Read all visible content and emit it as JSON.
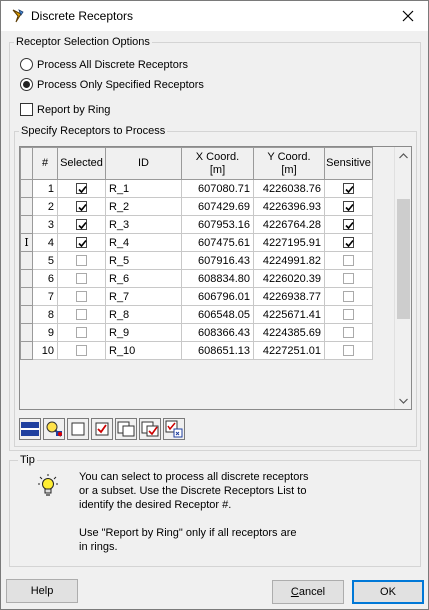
{
  "window": {
    "title": "Discrete Receptors",
    "icon": "receptor-app-icon"
  },
  "selection_options": {
    "label": "Receptor Selection Options",
    "process_all_label": "Process All Discrete Receptors",
    "process_specified_label": "Process Only Specified Receptors",
    "selected_option": "process_specified",
    "report_by_ring_label": "Report by Ring",
    "report_by_ring_checked": false
  },
  "specify_group": {
    "label": "Specify Receptors to Process"
  },
  "grid": {
    "headers": {
      "num": "#",
      "selected": "Selected",
      "id": "ID",
      "x_line1": "X Coord.",
      "x_line2": "[m]",
      "y_line1": "Y Coord.",
      "y_line2": "[m]",
      "sensitive": "Sensitive"
    },
    "current_row_marker": "I",
    "rows": [
      {
        "num": "1",
        "selected": true,
        "id": "R_1",
        "x": "607080.71",
        "y": "4226038.76",
        "sensitive": true
      },
      {
        "num": "2",
        "selected": true,
        "id": "R_2",
        "x": "607429.69",
        "y": "4226396.93",
        "sensitive": true
      },
      {
        "num": "3",
        "selected": true,
        "id": "R_3",
        "x": "607953.16",
        "y": "4226764.28",
        "sensitive": true
      },
      {
        "num": "4",
        "selected": true,
        "id": "R_4",
        "x": "607475.61",
        "y": "4227195.91",
        "sensitive": true
      },
      {
        "num": "5",
        "selected": false,
        "id": "R_5",
        "x": "607916.43",
        "y": "4224991.82",
        "sensitive": false
      },
      {
        "num": "6",
        "selected": false,
        "id": "R_6",
        "x": "608834.80",
        "y": "4226020.39",
        "sensitive": false
      },
      {
        "num": "7",
        "selected": false,
        "id": "R_7",
        "x": "606796.01",
        "y": "4226938.77",
        "sensitive": false
      },
      {
        "num": "8",
        "selected": false,
        "id": "R_8",
        "x": "606548.05",
        "y": "4225671.41",
        "sensitive": false
      },
      {
        "num": "9",
        "selected": false,
        "id": "R_9",
        "x": "608366.43",
        "y": "4224385.69",
        "sensitive": false
      },
      {
        "num": "10",
        "selected": false,
        "id": "R_10",
        "x": "608651.13",
        "y": "4227251.01",
        "sensitive": false
      }
    ]
  },
  "toolbar": {
    "icons": [
      "select-all-rows-icon",
      "find-receptor-icon",
      "uncheck-all-icon",
      "check-all-icon",
      "uncheck-range-icon",
      "check-range-icon",
      "check-sensitive-icon"
    ]
  },
  "tip": {
    "label": "Tip",
    "icon": "lightbulb-icon",
    "line1": "You can select to process all discrete receptors",
    "line2": "or a subset.  Use the Discrete Receptors List to",
    "line3": "identify the desired Receptor #.",
    "line4": "Use \"Report by Ring\" only if all receptors are",
    "line5": "in rings."
  },
  "buttons": {
    "help": "Help",
    "cancel": "Cancel",
    "ok": "OK"
  },
  "colors": {
    "accent": "#0078d7",
    "check_red": "#cc0000"
  }
}
